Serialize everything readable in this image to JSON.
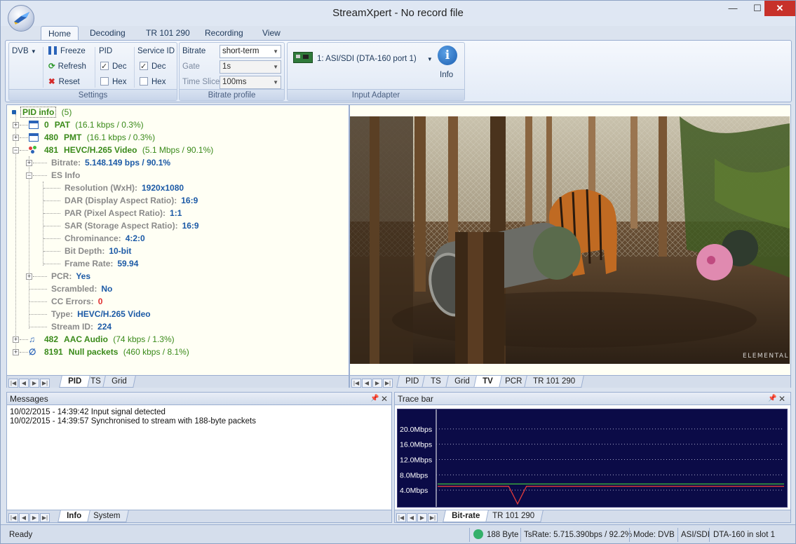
{
  "window": {
    "title": "StreamXpert - No record file"
  },
  "ribbon": {
    "tabs": [
      "Home",
      "Decoding",
      "TR 101 290",
      "Recording",
      "View"
    ],
    "settings": {
      "dvb_label": "DVB",
      "freeze_label": "Freeze",
      "refresh_label": "Refresh",
      "reset_label": "Reset",
      "pid_label": "PID",
      "service_id_label": "Service ID",
      "dec_label": "Dec",
      "hex_label": "Hex",
      "group_label": "Settings"
    },
    "bitrate_profile": {
      "bitrate_label": "Bitrate",
      "bitrate_value": "short-term",
      "gate_label": "Gate",
      "gate_value": "1s",
      "time_slice_label": "Time Slice",
      "time_slice_value": "100ms",
      "group_label": "Bitrate profile"
    },
    "input_adapter": {
      "adapter_value": "1: ASI/SDI (DTA-160 port 1)",
      "info_label": "Info",
      "group_label": "Input Adapter"
    }
  },
  "tree": {
    "root_label": "PID info",
    "root_count": "(5)",
    "pids": [
      {
        "pid": "0",
        "name": "PAT",
        "sub": "(16.1 kbps / 0.3%)"
      },
      {
        "pid": "480",
        "name": "PMT",
        "sub": "(16.1 kbps / 0.3%)"
      },
      {
        "pid": "481",
        "name": "HEVC/H.265 Video",
        "sub": "(5.1 Mbps / 90.1%)"
      },
      {
        "pid": "482",
        "name": "AAC Audio",
        "sub": "(74 kbps / 1.3%)"
      },
      {
        "pid": "8191",
        "name": "Null packets",
        "sub": "(460 kbps / 8.1%)"
      }
    ],
    "video_props": [
      {
        "label": "Bitrate:",
        "value": "5.148.149 bps / 90.1%"
      },
      {
        "label": "ES Info",
        "value": ""
      },
      {
        "label": "Resolution (WxH):",
        "value": "1920x1080"
      },
      {
        "label": "DAR (Display Aspect Ratio):",
        "value": "16:9"
      },
      {
        "label": "PAR (Pixel Aspect Ratio):",
        "value": "1:1"
      },
      {
        "label": "SAR (Storage Aspect Ratio):",
        "value": "16:9"
      },
      {
        "label": "Chrominance:",
        "value": "4:2:0"
      },
      {
        "label": "Bit Depth:",
        "value": "10-bit"
      },
      {
        "label": "Frame Rate:",
        "value": "59.94"
      },
      {
        "label": "PCR:",
        "value": "Yes"
      },
      {
        "label": "Scrambled:",
        "value": "No"
      },
      {
        "label": "CC Errors:",
        "value": "0"
      },
      {
        "label": "Type:",
        "value": "HEVC/H.265 Video"
      },
      {
        "label": "Stream ID:",
        "value": "224"
      }
    ]
  },
  "left_tabs": [
    "PID",
    "TS",
    "Grid"
  ],
  "right_tabs": [
    "PID",
    "TS",
    "Grid",
    "TV",
    "PCR",
    "TR 101 290"
  ],
  "video": {
    "watermark": "ELEMENTAL"
  },
  "messages": {
    "title": "Messages",
    "lines": [
      "10/02/2015 - 14:39:42 Input signal detected",
      "10/02/2015 - 14:39:57 Synchronised to stream with 188-byte packets"
    ],
    "tabs": [
      "Info",
      "System"
    ]
  },
  "trace": {
    "title": "Trace bar",
    "tabs": [
      "Bit-rate",
      "TR 101 290"
    ]
  },
  "chart_data": {
    "type": "line",
    "title": "",
    "ylabels": [
      "20.0Mbps",
      "16.0Mbps",
      "12.0Mbps",
      "8.0Mbps",
      "4.0Mbps"
    ],
    "ylim": [
      0,
      24
    ],
    "series": [
      {
        "color": "#e23b3b",
        "values": [
          5.0,
          5.0,
          5.0,
          5.0,
          5.0,
          5.0,
          5.0,
          5.0,
          5.0,
          0.4,
          5.0,
          5.0,
          5.0,
          5.0,
          5.0,
          5.0,
          5.0,
          5.0,
          5.0,
          5.0,
          5.0,
          5.0,
          5.0,
          5.0,
          5.0,
          5.0,
          5.0,
          5.0,
          5.0,
          5.0,
          5.0,
          5.0,
          5.0,
          5.0,
          5.0,
          5.0,
          5.0,
          5.0,
          5.0,
          5.0
        ]
      },
      {
        "color": "#3fbf3f",
        "values": [
          5.6,
          5.6,
          5.6,
          5.6,
          5.6,
          5.6,
          5.6,
          5.6,
          5.6,
          5.6,
          5.6,
          5.6,
          5.6,
          5.6,
          5.6,
          5.6,
          5.6,
          5.6,
          5.6,
          5.6,
          5.6,
          5.6,
          5.6,
          5.6,
          5.6,
          5.6,
          5.6,
          5.6,
          5.6,
          5.6,
          5.6,
          5.6,
          5.6,
          5.6,
          5.6,
          5.6,
          5.6,
          5.6,
          5.6,
          5.6
        ]
      }
    ],
    "grid": true
  },
  "status": {
    "ready": "Ready",
    "packet_size": "188 Byte",
    "tsrate": "TsRate: 5.715.390bps / 92.2%",
    "mode": "Mode: DVB",
    "interface": "ASI/SDI",
    "device": "DTA-160 in slot 1"
  }
}
